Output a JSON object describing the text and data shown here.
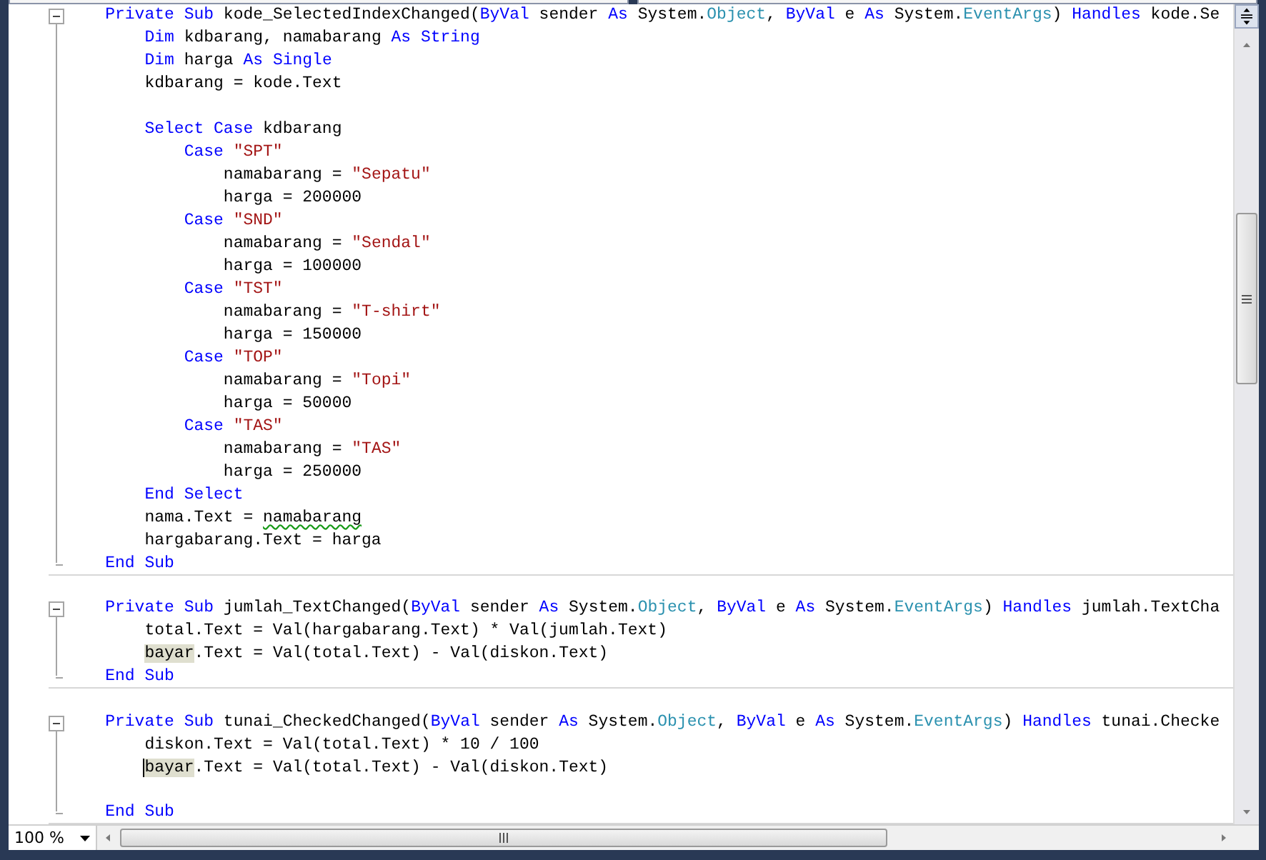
{
  "editor": {
    "lines": [
      {
        "in_block": true,
        "block_start": true,
        "block_end": false,
        "tokens": [
          {
            "kind": "kw",
            "text": "    Private Sub"
          },
          {
            "kind": "plain",
            "text": " kode_SelectedIndexChanged("
          },
          {
            "kind": "kw",
            "text": "ByVal"
          },
          {
            "kind": "plain",
            "text": " sender "
          },
          {
            "kind": "kw",
            "text": "As"
          },
          {
            "kind": "plain",
            "text": " System."
          },
          {
            "kind": "type",
            "text": "Object"
          },
          {
            "kind": "plain",
            "text": ", "
          },
          {
            "kind": "kw",
            "text": "ByVal"
          },
          {
            "kind": "plain",
            "text": " e "
          },
          {
            "kind": "kw",
            "text": "As"
          },
          {
            "kind": "plain",
            "text": " System."
          },
          {
            "kind": "type",
            "text": "EventArgs"
          },
          {
            "kind": "plain",
            "text": ") "
          },
          {
            "kind": "kw",
            "text": "Handles"
          },
          {
            "kind": "plain",
            "text": " kode.Se"
          }
        ]
      },
      {
        "in_block": true,
        "block_start": false,
        "block_end": false,
        "tokens": [
          {
            "kind": "kw",
            "text": "        Dim"
          },
          {
            "kind": "plain",
            "text": " kdbarang, namabarang "
          },
          {
            "kind": "kw",
            "text": "As String"
          }
        ]
      },
      {
        "in_block": true,
        "block_start": false,
        "block_end": false,
        "tokens": [
          {
            "kind": "kw",
            "text": "        Dim"
          },
          {
            "kind": "plain",
            "text": " harga "
          },
          {
            "kind": "kw",
            "text": "As Single"
          }
        ]
      },
      {
        "in_block": true,
        "block_start": false,
        "block_end": false,
        "tokens": [
          {
            "kind": "plain",
            "text": "        kdbarang = kode.Text"
          }
        ]
      },
      {
        "in_block": true,
        "block_start": false,
        "block_end": false
      },
      {
        "in_block": true,
        "block_start": false,
        "block_end": false,
        "tokens": [
          {
            "kind": "kw",
            "text": "        Select Case"
          },
          {
            "kind": "plain",
            "text": " kdbarang"
          }
        ]
      },
      {
        "in_block": true,
        "block_start": false,
        "block_end": false,
        "tokens": [
          {
            "kind": "kw",
            "text": "            Case "
          },
          {
            "kind": "str",
            "text": "\"SPT\""
          }
        ]
      },
      {
        "in_block": true,
        "block_start": false,
        "block_end": false,
        "tokens": [
          {
            "kind": "plain",
            "text": "                namabarang = "
          },
          {
            "kind": "str",
            "text": "\"Sepatu\""
          }
        ]
      },
      {
        "in_block": true,
        "block_start": false,
        "block_end": false,
        "tokens": [
          {
            "kind": "plain",
            "text": "                harga = 200000"
          }
        ]
      },
      {
        "in_block": true,
        "block_start": false,
        "block_end": false,
        "tokens": [
          {
            "kind": "kw",
            "text": "            Case "
          },
          {
            "kind": "str",
            "text": "\"SND\""
          }
        ]
      },
      {
        "in_block": true,
        "block_start": false,
        "block_end": false,
        "tokens": [
          {
            "kind": "plain",
            "text": "                namabarang = "
          },
          {
            "kind": "str",
            "text": "\"Sendal\""
          }
        ]
      },
      {
        "in_block": true,
        "block_start": false,
        "block_end": false,
        "tokens": [
          {
            "kind": "plain",
            "text": "                harga = 100000"
          }
        ]
      },
      {
        "in_block": true,
        "block_start": false,
        "block_end": false,
        "tokens": [
          {
            "kind": "kw",
            "text": "            Case "
          },
          {
            "kind": "str",
            "text": "\"TST\""
          }
        ]
      },
      {
        "in_block": true,
        "block_start": false,
        "block_end": false,
        "tokens": [
          {
            "kind": "plain",
            "text": "                namabarang = "
          },
          {
            "kind": "str",
            "text": "\"T-shirt\""
          }
        ]
      },
      {
        "in_block": true,
        "block_start": false,
        "block_end": false,
        "tokens": [
          {
            "kind": "plain",
            "text": "                harga = 150000"
          }
        ]
      },
      {
        "in_block": true,
        "block_start": false,
        "block_end": false,
        "tokens": [
          {
            "kind": "kw",
            "text": "            Case "
          },
          {
            "kind": "str",
            "text": "\"TOP\""
          }
        ]
      },
      {
        "in_block": true,
        "block_start": false,
        "block_end": false,
        "tokens": [
          {
            "kind": "plain",
            "text": "                namabarang = "
          },
          {
            "kind": "str",
            "text": "\"Topi\""
          }
        ]
      },
      {
        "in_block": true,
        "block_start": false,
        "block_end": false,
        "tokens": [
          {
            "kind": "plain",
            "text": "                harga = 50000"
          }
        ]
      },
      {
        "in_block": true,
        "block_start": false,
        "block_end": false,
        "tokens": [
          {
            "kind": "kw",
            "text": "            Case "
          },
          {
            "kind": "str",
            "text": "\"TAS\""
          }
        ]
      },
      {
        "in_block": true,
        "block_start": false,
        "block_end": false,
        "tokens": [
          {
            "kind": "plain",
            "text": "                namabarang = "
          },
          {
            "kind": "str",
            "text": "\"TAS\""
          }
        ]
      },
      {
        "in_block": true,
        "block_start": false,
        "block_end": false,
        "tokens": [
          {
            "kind": "plain",
            "text": "                harga = 250000"
          }
        ]
      },
      {
        "in_block": true,
        "block_start": false,
        "block_end": false,
        "tokens": [
          {
            "kind": "kw",
            "text": "        End Select"
          }
        ]
      },
      {
        "in_block": true,
        "block_start": false,
        "block_end": false,
        "tokens": [
          {
            "kind": "plain",
            "text": "        nama.Text = "
          },
          {
            "kind": "plain",
            "text": "namabarang",
            "squiggle": true
          }
        ]
      },
      {
        "in_block": true,
        "block_start": false,
        "block_end": false,
        "tokens": [
          {
            "kind": "plain",
            "text": "        hargabarang.Text = harga"
          }
        ]
      },
      {
        "in_block": true,
        "block_start": false,
        "block_end": true,
        "tokens": [
          {
            "kind": "kw",
            "text": "    End Sub"
          }
        ]
      },
      {
        "in_block": false,
        "block_start": false,
        "block_end": false
      },
      {
        "in_block": true,
        "block_start": true,
        "block_end": false,
        "tokens": [
          {
            "kind": "kw",
            "text": "    Private Sub"
          },
          {
            "kind": "plain",
            "text": " jumlah_TextChanged("
          },
          {
            "kind": "kw",
            "text": "ByVal"
          },
          {
            "kind": "plain",
            "text": " sender "
          },
          {
            "kind": "kw",
            "text": "As"
          },
          {
            "kind": "plain",
            "text": " System."
          },
          {
            "kind": "type",
            "text": "Object"
          },
          {
            "kind": "plain",
            "text": ", "
          },
          {
            "kind": "kw",
            "text": "ByVal"
          },
          {
            "kind": "plain",
            "text": " e "
          },
          {
            "kind": "kw",
            "text": "As"
          },
          {
            "kind": "plain",
            "text": " System."
          },
          {
            "kind": "type",
            "text": "EventArgs"
          },
          {
            "kind": "plain",
            "text": ") "
          },
          {
            "kind": "kw",
            "text": "Handles"
          },
          {
            "kind": "plain",
            "text": " jumlah.TextCha"
          }
        ]
      },
      {
        "in_block": true,
        "block_start": false,
        "block_end": false,
        "tokens": [
          {
            "kind": "plain",
            "text": "        total.Text = Val(hargabarang.Text) * Val(jumlah.Text)"
          }
        ]
      },
      {
        "in_block": true,
        "block_start": false,
        "block_end": false,
        "tokens": [
          {
            "kind": "plain",
            "text": "        bayar",
            "highlighted": true
          },
          {
            "kind": "plain",
            "text": ".Text = Val(total.Text) - Val(diskon.Text)"
          }
        ]
      },
      {
        "in_block": true,
        "block_start": false,
        "block_end": true,
        "tokens": [
          {
            "kind": "kw",
            "text": "    End Sub"
          }
        ]
      },
      {
        "in_block": false,
        "block_start": false,
        "block_end": false
      },
      {
        "in_block": true,
        "block_start": true,
        "block_end": false,
        "tokens": [
          {
            "kind": "kw",
            "text": "    Private Sub"
          },
          {
            "kind": "plain",
            "text": " tunai_CheckedChanged("
          },
          {
            "kind": "kw",
            "text": "ByVal"
          },
          {
            "kind": "plain",
            "text": " sender "
          },
          {
            "kind": "kw",
            "text": "As"
          },
          {
            "kind": "plain",
            "text": " System."
          },
          {
            "kind": "type",
            "text": "Object"
          },
          {
            "kind": "plain",
            "text": ", "
          },
          {
            "kind": "kw",
            "text": "ByVal"
          },
          {
            "kind": "plain",
            "text": " e "
          },
          {
            "kind": "kw",
            "text": "As"
          },
          {
            "kind": "plain",
            "text": " System."
          },
          {
            "kind": "type",
            "text": "EventArgs"
          },
          {
            "kind": "plain",
            "text": ") "
          },
          {
            "kind": "kw",
            "text": "Handles"
          },
          {
            "kind": "plain",
            "text": " tunai.Checke"
          }
        ]
      },
      {
        "in_block": true,
        "block_start": false,
        "block_end": false,
        "tokens": [
          {
            "kind": "plain",
            "text": "        diskon.Text = Val(total.Text) * 10 / 100"
          }
        ]
      },
      {
        "in_block": true,
        "block_start": false,
        "block_end": false,
        "tokens": [
          {
            "kind": "plain",
            "text": "        bayar",
            "highlighted": true,
            "caret": true
          },
          {
            "kind": "plain",
            "text": ".Text = Val(total.Text) - Val(diskon.Text)"
          }
        ]
      },
      {
        "in_block": true,
        "block_start": false,
        "block_end": false
      },
      {
        "in_block": true,
        "block_start": false,
        "block_end": true,
        "tokens": [
          {
            "kind": "kw",
            "text": "    End Sub"
          }
        ]
      }
    ]
  },
  "status_bar": {
    "zoom": "100 %"
  }
}
